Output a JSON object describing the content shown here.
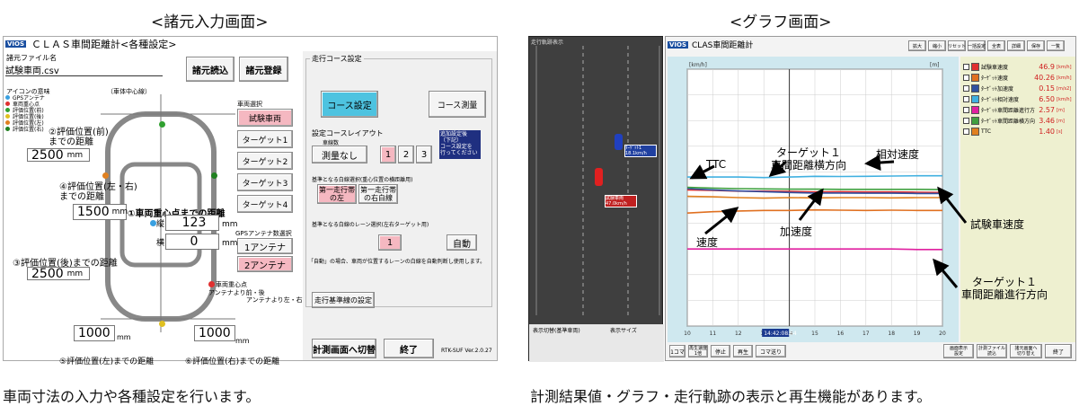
{
  "headers": {
    "left": "<諸元入力画面>",
    "right": "<グラフ画面>"
  },
  "captions": {
    "left": "車両寸法の入力や各種設定を行います。",
    "right": "計測結果値・グラフ・走行軌跡の表示と再生機能があります。"
  },
  "settings": {
    "logo": "VIOS",
    "title": "ＣＬＡＳ車間距離計<各種設定>",
    "file_label": "諸元ファイル名",
    "file_value": "試験車両.csv",
    "btn_load": "諸元読込",
    "btn_save": "諸元登録",
    "legend_title": "アイコンの意味",
    "legend_items": [
      {
        "text": "GPSアンテナ",
        "color": "#3aa0e0"
      },
      {
        "text": "車両重心点",
        "color": "#e03030"
      },
      {
        "text": "評価位置(前)",
        "color": "#30a030"
      },
      {
        "text": "評価位置(後)",
        "color": "#e0c020"
      },
      {
        "text": "評価位置(左)",
        "color": "#e08020"
      },
      {
        "text": "評価位置(右)",
        "color": "#208020"
      }
    ],
    "vehicle_center": "（車体中心線）",
    "front_label": "②評価位置(前)\nまでの距離",
    "front_value": "2500",
    "front_unit": "mm",
    "lr_label": "④評価位置(左・右)\nまでの距離",
    "lr_value": "1500",
    "lr_unit": "mm",
    "cg_label": "①車両重心点までの距離",
    "cg_long_label": "縦",
    "cg_long_value": "123",
    "cg_lat_label": "横",
    "cg_lat_value": "0",
    "cg_unit": "mm",
    "rear_label": "③評価位置(後)までの距離",
    "rear_value": "2500",
    "rear_unit": "mm",
    "antenna_note1": "車両重心点",
    "antenna_note2": "アンテナより前・後",
    "antenna_note3": "アンテナより左・右",
    "left_pos_value": "1000",
    "right_pos_value": "1000",
    "bottom_unit": "mm",
    "left_pos_label": "⑤評価位置(左)までの距離",
    "right_pos_label": "⑥評価位置(右)までの距離",
    "vehicle_select_title": "車両選択",
    "vehicles": [
      "試験車両",
      "ターゲット1",
      "ターゲット2",
      "ターゲット3",
      "ターゲット4"
    ],
    "gps_title": "GPSアンテナ数選択",
    "gps_options": [
      "1アンテナ",
      "2アンテナ"
    ],
    "course_title": "走行コース設定",
    "btn_course_set": "コース設定",
    "btn_course_measure": "コース測量",
    "layout_title": "設定コースレイアウト",
    "lanes_label": "車線数",
    "btn_no_measure": "測量なし",
    "lane_nums": [
      "1",
      "2",
      "3"
    ],
    "lane_note": "追加設定後\n（下記）\nコース設定を\n行ってください",
    "ref_title": "基準となる白線選択(重心位置の横距離用)",
    "ref_opts": [
      "第一走行帯\nの左",
      "第一走行帯\nの右白線"
    ],
    "lane_ref_title": "基準となる白線のレーン選択(左右ターゲット用)",
    "lane_ref_num": "1",
    "btn_auto": "自動",
    "auto_note": "「自動」の場合、車両が位置するレーンの白線を自動判断し使用します。",
    "btn_travel_std": "走行基準線の設定",
    "btn_switch": "計測画面へ切替",
    "btn_exit": "終了",
    "version": "RTK-SUF Ver.2.0.27"
  },
  "graph": {
    "track_title": "走行軌跡表示",
    "logo": "VIOS",
    "title": "CLAS車間距離計",
    "top_buttons": [
      "拡大",
      "縮小",
      "リセット",
      "一括設定",
      "全表",
      "詳細",
      "保存",
      "一覧"
    ],
    "y_unit_left": "[km/h]",
    "y_unit_right": "[m]",
    "y_ticks_left": [
      "",
      "",
      "",
      "",
      "",
      "",
      "",
      ""
    ],
    "x_ticks": [
      "10",
      "11",
      "12",
      "13",
      "14",
      "15",
      "16",
      "17",
      "18",
      "19",
      "20"
    ],
    "legend": [
      {
        "label": "試験車速度",
        "value": "46.9",
        "unit": "[km/h]",
        "color": "#e03030"
      },
      {
        "label": "ﾀｰｹﾞｯﾄ速度",
        "value": "40.26",
        "unit": "[km/h]",
        "color": "#e07020"
      },
      {
        "label": "ﾀｰｹﾞｯﾄ加速度",
        "value": "0.15",
        "unit": "[m/s2]",
        "color": "#3050a0"
      },
      {
        "label": "ﾀｰｹﾞｯﾄ相対速度",
        "value": "6.50",
        "unit": "[km/h]",
        "color": "#40b0e0"
      },
      {
        "label": "ﾀｰｹﾞｯﾄ車間距離進行方",
        "value": "2.57",
        "unit": "[m]",
        "color": "#e020a0"
      },
      {
        "label": "ﾀｰｹﾞｯﾄ車間距離横方向",
        "value": "3.46",
        "unit": "[m]",
        "color": "#40a040"
      },
      {
        "label": "TTC",
        "value": "1.40",
        "unit": "[s]",
        "color": "#e08020"
      }
    ],
    "ann": {
      "ttc": "TTC",
      "lat": "ターゲット１\n車間距離横方向",
      "rel": "相対速度",
      "accel": "加速度",
      "speed": "速度",
      "test_speed": "試験車速度",
      "long": "ターゲット１\n車間距離進行方向"
    },
    "track_labels": {
      "target": "ﾀｰｹﾞｯﾄ1\n18.1km/h",
      "test": "試験車両\n47.0km/h"
    },
    "bottom": {
      "mode_title": "表示切替(基準車両)",
      "size_title": "表示サイズ",
      "btn_play": "再生",
      "btn_stop": "停止",
      "btn_frame": "1コマ",
      "speed_label": "再生速度\n1倍",
      "step_label": "コマ送り",
      "btn_graph_set": "画面表示\n設定",
      "btn_file": "計測ファイル\n読込",
      "btn_switch": "諸元画面へ\n切り替え",
      "btn_exit": "終了"
    },
    "time_marker": "14:42:08.64"
  },
  "chart_data": {
    "type": "line",
    "x": [
      10,
      11,
      12,
      13,
      14,
      15,
      16,
      17,
      18,
      19,
      20
    ],
    "series": [
      {
        "name": "試験車速度",
        "values": [
          53,
          52.8,
          52.5,
          52.5,
          52.4,
          52.2,
          52.3,
          52.2,
          52.2,
          52.1,
          52
        ]
      },
      {
        "name": "ﾀｰｹﾞｯﾄ速度",
        "values": [
          44,
          44.5,
          44.8,
          45,
          45,
          45.2,
          45.1,
          45,
          45.1,
          45,
          45
        ]
      },
      {
        "name": "ﾀｰｹﾞｯﾄ加速度",
        "values": [
          53.5,
          53,
          52.6,
          52.3,
          52,
          51.8,
          51.8,
          51.7,
          51.7,
          51.6,
          51.6
        ]
      },
      {
        "name": "ﾀｰｹﾞｯﾄ相対速度",
        "values": [
          58,
          58,
          58,
          57.8,
          58,
          58.3,
          58.2,
          58.3,
          58.4,
          58.5,
          58.5
        ]
      },
      {
        "name": "ﾀｰｹﾞｯﾄ車間距離進行方",
        "values": [
          30,
          30,
          30,
          30,
          30,
          30,
          30,
          30,
          30,
          29.8,
          29.8
        ]
      },
      {
        "name": "ﾀｰｹﾞｯﾄ車間距離横方向",
        "values": [
          54,
          53.7,
          53.5,
          53.4,
          53.3,
          53.3,
          53.2,
          53.2,
          53.2,
          53.2,
          53.1
        ]
      },
      {
        "name": "TTC",
        "values": [
          50.5,
          50.3,
          50,
          49.8,
          50,
          49.9,
          50,
          50,
          49.9,
          50,
          50
        ]
      }
    ],
    "ylim": [
      0,
      100
    ]
  }
}
